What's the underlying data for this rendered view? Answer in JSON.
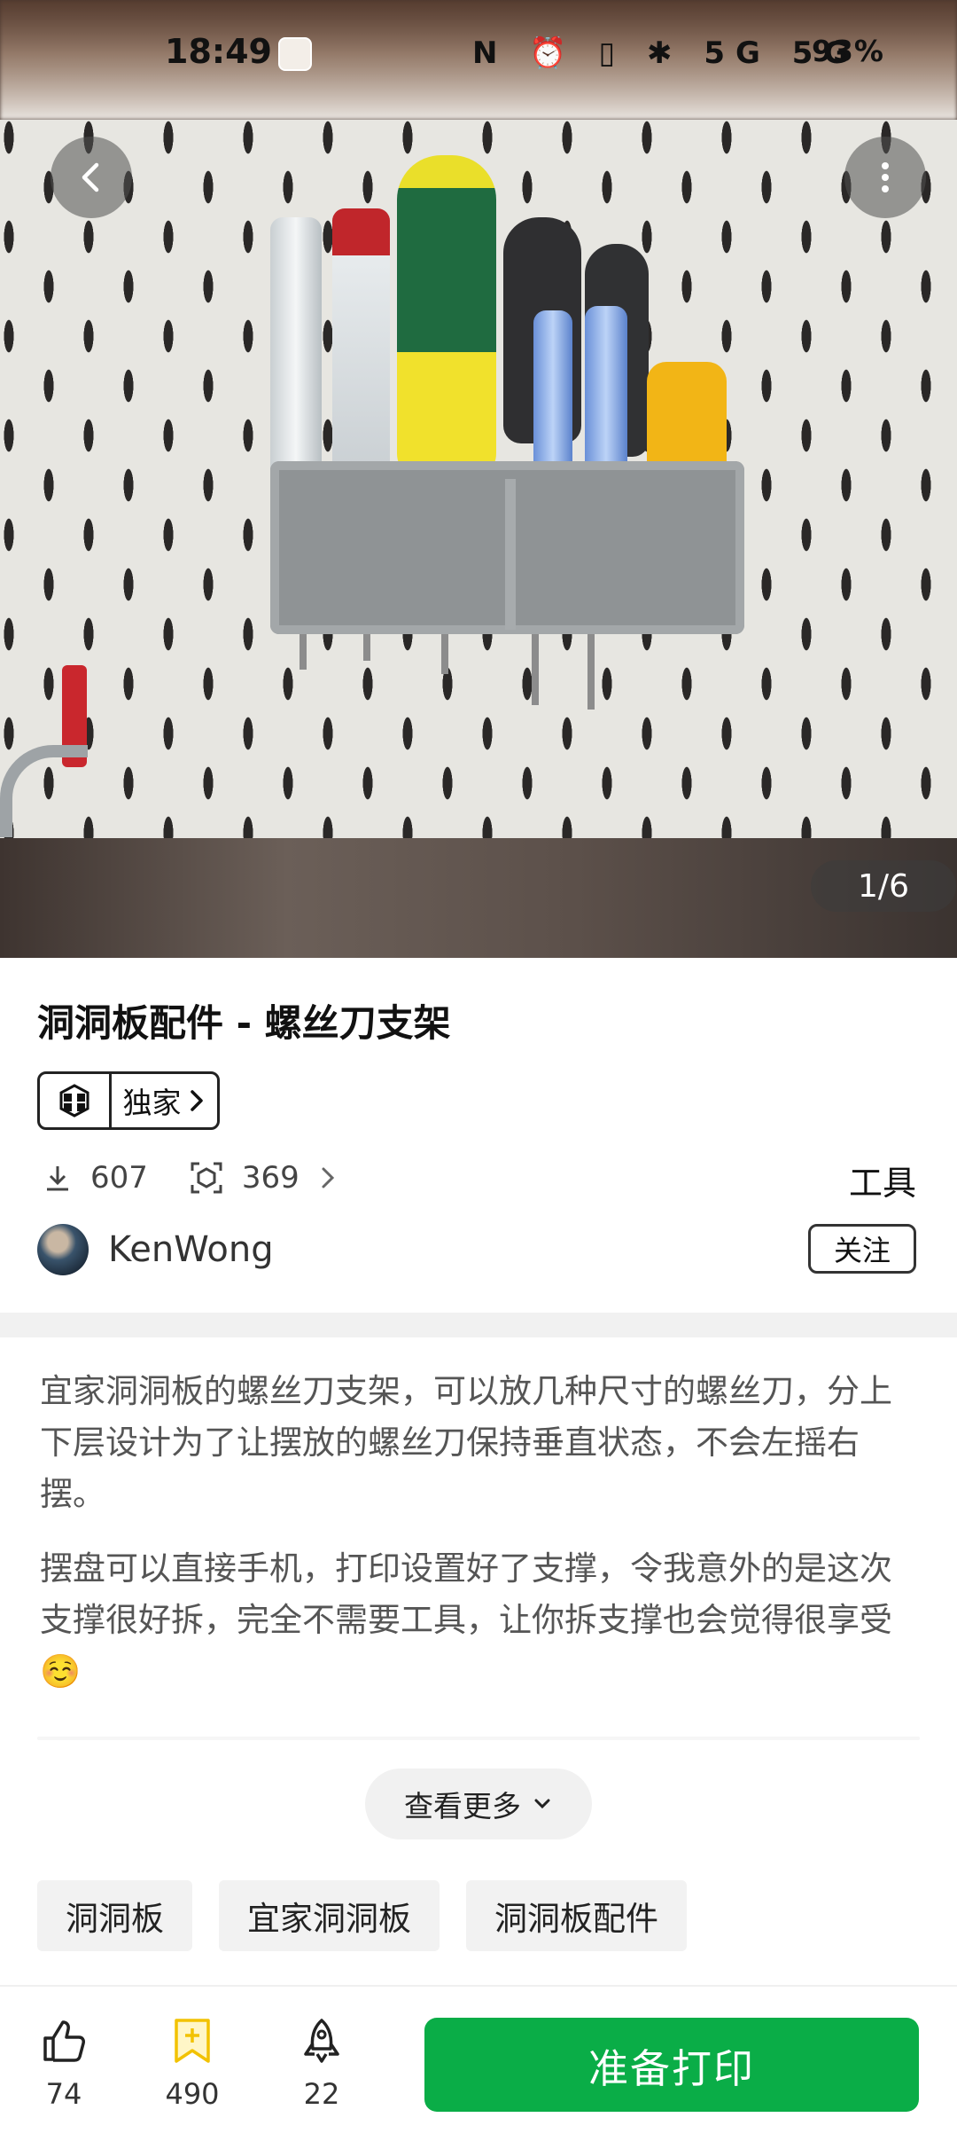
{
  "status_bar": {
    "time": "18:49",
    "network_icons": "N ⏰ ▯ ✱ 5G 5G",
    "battery": "93%"
  },
  "gallery": {
    "counter": "1/6"
  },
  "model": {
    "title": "洞洞板配件 - 螺丝刀支架",
    "badge_label": "独家",
    "downloads": "607",
    "makes": "369",
    "category": "工具"
  },
  "author": {
    "name": "KenWong",
    "follow_label": "关注"
  },
  "description": {
    "paragraph1": "宜家洞洞板的螺丝刀支架，可以放几种尺寸的螺丝刀，分上下层设计为了让摆放的螺丝刀保持垂直状态，不会左摇右摆。",
    "paragraph2": "摆盘可以直接手机，打印设置好了支撑，令我意外的是这次支撑很好拆，完全不需要工具，让你拆支撑也会觉得很享受☺️",
    "see_more_label": "查看更多"
  },
  "tags": [
    "洞洞板",
    "宜家洞洞板",
    "洞洞板配件"
  ],
  "bottom_bar": {
    "likes": "74",
    "favorites": "490",
    "boosts": "22",
    "print_label": "准备打印"
  },
  "colors": {
    "primary_green": "#0aad47",
    "favorite_yellow": "#f2c200"
  }
}
